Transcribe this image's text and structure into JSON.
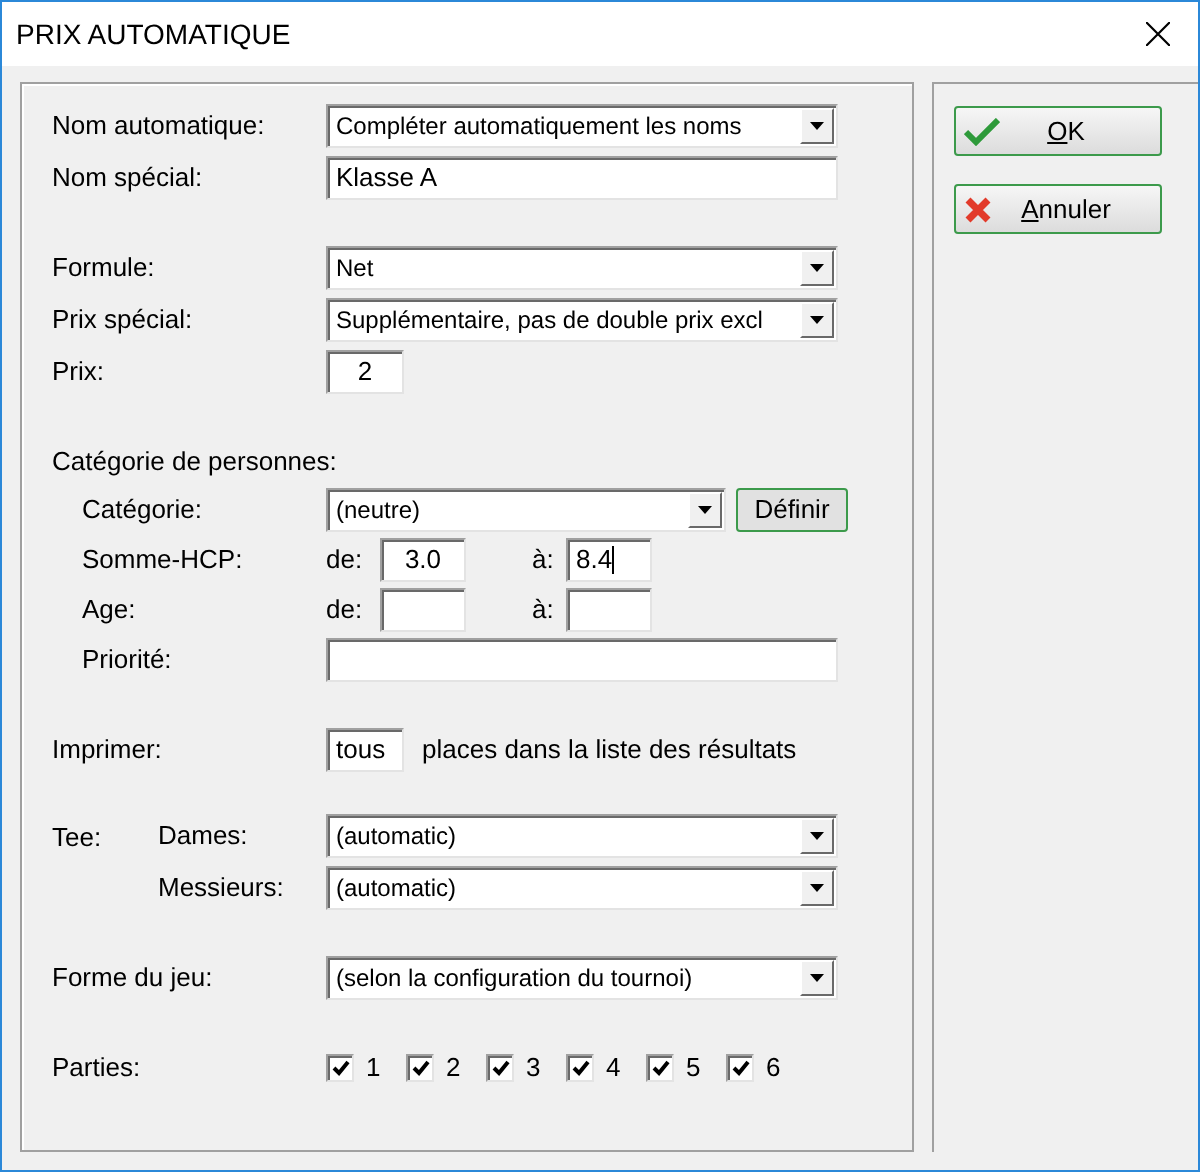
{
  "window": {
    "title": "PRIX AUTOMATIQUE"
  },
  "groups": [
    [
      {
        "kind": "dropdown",
        "label": "Nom automatique:",
        "value": "Compléter automatiquement les noms"
      },
      {
        "kind": "text",
        "label": "Nom spécial:",
        "value": "Klasse A"
      }
    ],
    [
      {
        "kind": "dropdown",
        "label": "Formule:",
        "value": "Net"
      },
      {
        "kind": "dropdown",
        "label": "Prix spécial:",
        "value": "Supplémentaire, pas de double prix excl"
      },
      {
        "kind": "small_text",
        "label": "Prix:",
        "value": "2"
      }
    ],
    [
      {
        "kind": "heading",
        "label": "Catégorie de personnes:",
        "children": [
          {
            "kind": "dropdown_button",
            "label": "Catégorie:",
            "value": "(neutre)",
            "button": "Définir"
          },
          {
            "kind": "range",
            "label": "Somme-HCP:",
            "from_label": "de:",
            "from_value": "3.0",
            "to_label": "à:",
            "to_value": "8.4",
            "focused": true
          },
          {
            "kind": "range",
            "label": "Age:",
            "from_label": "de:",
            "to_label": "à:",
            "focused": false
          },
          {
            "kind": "text",
            "label": "Priorité:"
          }
        ]
      }
    ],
    [
      {
        "kind": "print",
        "label": "Imprimer:",
        "value": "tous",
        "suffix": "places dans la liste des résultats"
      }
    ],
    [
      {
        "kind": "sub_group",
        "label": "Tee:",
        "children": [
          {
            "kind": "dropdown",
            "label": "Dames:",
            "value": "(automatic)"
          },
          {
            "kind": "dropdown",
            "label": "Messieurs:",
            "value": "(automatic)"
          }
        ]
      }
    ],
    [
      {
        "kind": "dropdown",
        "label": "Forme du jeu:",
        "value": "(selon la configuration du tournoi)"
      }
    ],
    [
      {
        "kind": "checkboxes",
        "label": "Parties:",
        "items": [
          {
            "label": "1",
            "checked": true
          },
          {
            "label": "2",
            "checked": true
          },
          {
            "label": "3",
            "checked": true
          },
          {
            "label": "4",
            "checked": true
          },
          {
            "label": "5",
            "checked": true
          },
          {
            "label": "6",
            "checked": true
          }
        ]
      }
    ]
  ],
  "buttons": [
    {
      "label": "OK",
      "kind": "ok"
    },
    {
      "label": "Annuler",
      "kind": "cancel"
    }
  ]
}
